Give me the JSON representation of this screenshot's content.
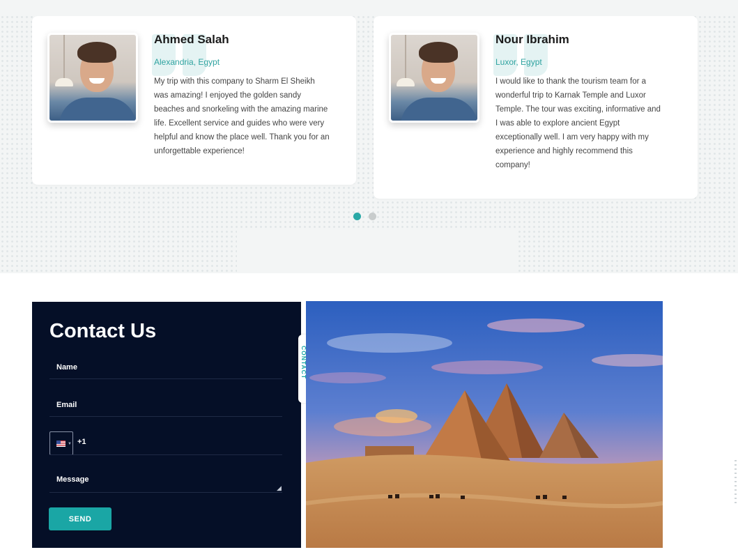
{
  "testimonials": [
    {
      "name": "Ahmed Salah",
      "location": "Alexandria, Egypt",
      "text": "My trip with this company to Sharm El Sheikh was amazing! I enjoyed the golden sandy beaches and snorkeling with the amazing marine life. Excellent service and guides who were very helpful and know the place well. Thank you for an unforgettable experience!"
    },
    {
      "name": "Nour Ibrahim",
      "location": "Luxor, Egypt",
      "text": "I would like to thank the tourism team for a wonderful trip to Karnak Temple and Luxor Temple. The tour was exciting, informative and I was able to explore ancient Egypt exceptionally well. I am very happy with my experience and highly recommend this company!"
    }
  ],
  "carousel": {
    "pages": 2,
    "active_index": 0
  },
  "contact": {
    "title": "Contact Us",
    "name_label": "Name",
    "email_label": "Email",
    "phone_prefix": "+1",
    "message_label": "Message",
    "send_label": "SEND",
    "side_tab_label": "CONTACT"
  },
  "colors": {
    "accent": "#1aa6a5",
    "panel": "#050f27",
    "band_bg": "#f3f5f5"
  },
  "icons": {
    "country_flag": "us-flag-icon",
    "resize": "resize-grip-icon"
  }
}
